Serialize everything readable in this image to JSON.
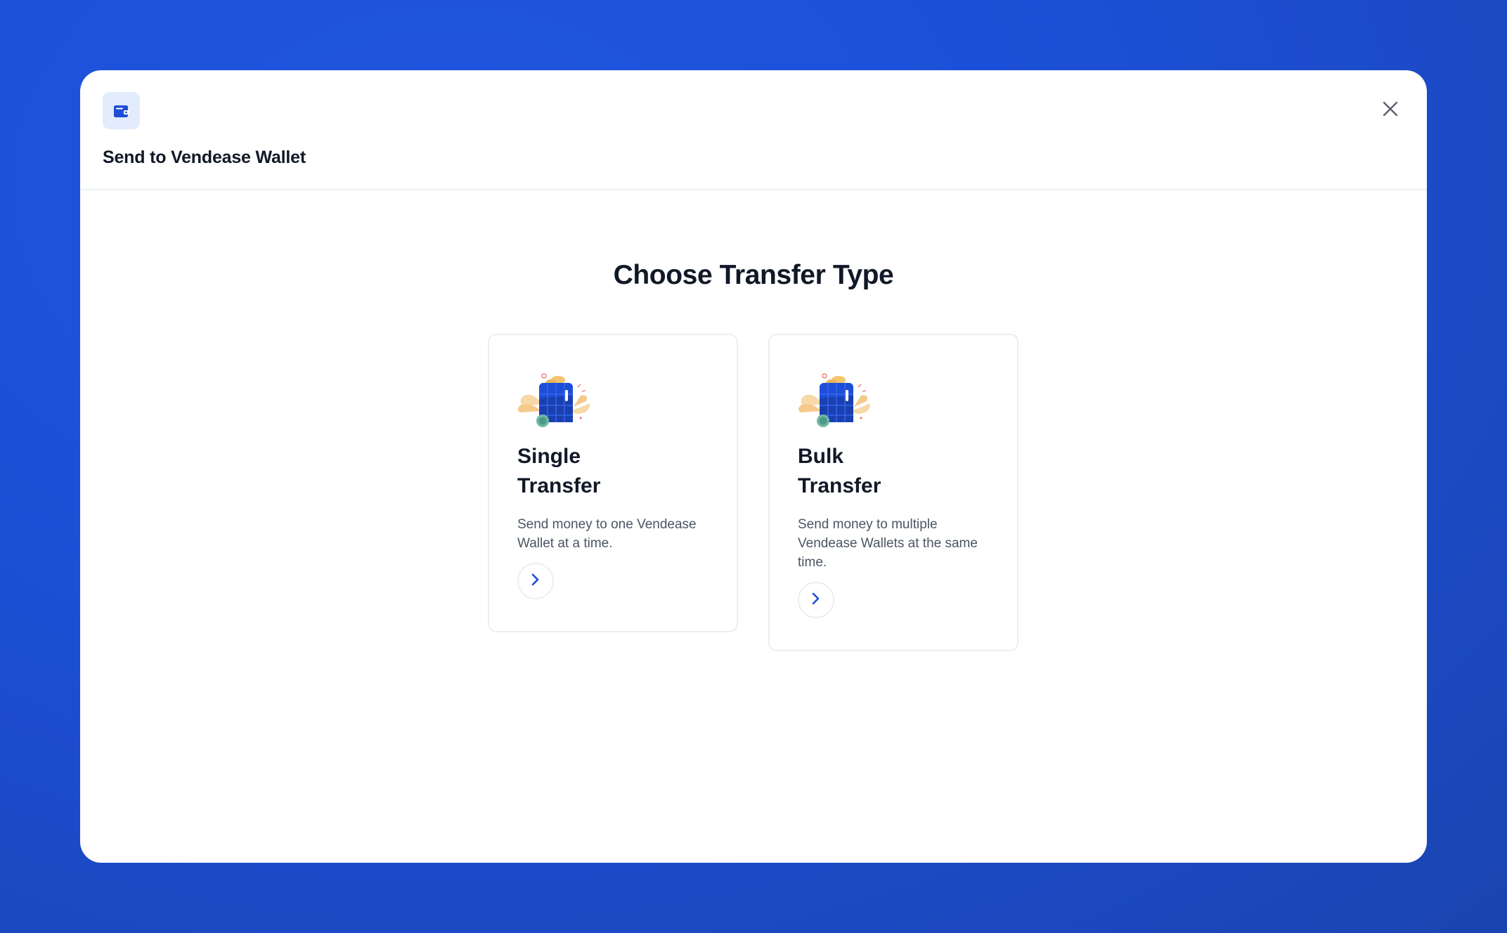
{
  "modal": {
    "header_icon": "wallet-icon",
    "title": "Send to Vendease Wallet",
    "close_icon": "close-icon"
  },
  "main": {
    "section_title": "Choose Transfer Type",
    "cards": [
      {
        "illustration": "wallet-money-illustration",
        "title": "Single Transfer",
        "description": "Send money to one Vendease Wallet at a time.",
        "action_icon": "chevron-right-icon"
      },
      {
        "illustration": "wallet-money-illustration",
        "title": "Bulk Transfer",
        "description": "Send money to multiple Vendease Wallets at the same time.",
        "action_icon": "chevron-right-icon"
      }
    ]
  },
  "colors": {
    "background": "#1c4fd6",
    "accent": "#1d4ed8",
    "icon_bg": "#e3ecfd",
    "text_primary": "#111827",
    "text_secondary": "#4b5563"
  }
}
